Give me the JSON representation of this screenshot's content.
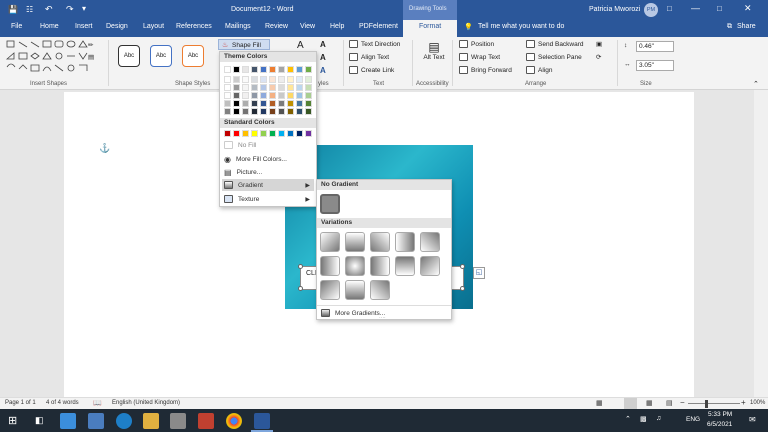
{
  "titlebar": {
    "doc_title": "Document12 - Word",
    "context_tab": "Drawing Tools",
    "search_hint": "Tell me what you want to do",
    "user": "Patricia Mworozi",
    "initials": "PM"
  },
  "tabs": [
    "File",
    "Home",
    "Insert",
    "Design",
    "Layout",
    "References",
    "Mailings",
    "Review",
    "View",
    "Help",
    "PDFelement",
    "Format"
  ],
  "share_label": "Share",
  "ribbon": {
    "groups": {
      "insert_shapes": "Insert Shapes",
      "shape_styles": "Shape Styles",
      "text": "Text",
      "accessibility": "Accessibility",
      "arrange": "Arrange",
      "size": "Size"
    },
    "abc": "Abc",
    "shape_fill": "Shape Fill",
    "text_direction": "Text Direction",
    "align_text": "Align Text",
    "create_link": "Create Link",
    "alt_text": "Alt Text",
    "position": "Position",
    "wrap_text": "Wrap Text",
    "bring_forward": "Bring Forward",
    "send_backward": "Send Backward",
    "selection_pane": "Selection Pane",
    "align": "Align",
    "height": "0.46\"",
    "width": "3.05\"",
    "styles_short": "yles"
  },
  "fill_menu": {
    "theme_colors": "Theme Colors",
    "standard_colors": "Standard Colors",
    "no_fill": "No Fill",
    "more_fill_colors": "More Fill Colors...",
    "picture": "Picture...",
    "gradient": "Gradient",
    "texture": "Texture"
  },
  "gradient_menu": {
    "no_gradient": "No Gradient",
    "variations": "Variations",
    "more_gradients": "More Gradients..."
  },
  "textbox_text": "CLE",
  "status": {
    "page": "Page 1 of 1",
    "words": "4 of 4 words",
    "language": "English (United Kingdom)",
    "zoom": "100%"
  },
  "taskbar": {
    "lang": "ENG",
    "time": "5:33 PM",
    "date": "6/5/2021"
  },
  "colors": {
    "accent": "#2b579a",
    "theme_top": [
      "#ffffff",
      "#000000",
      "#e7e6e6",
      "#44546a",
      "#4472c4",
      "#ed7d31",
      "#a5a5a5",
      "#ffc000",
      "#5b9bd5",
      "#70ad47"
    ],
    "standard": [
      "#c00000",
      "#ff0000",
      "#ffc000",
      "#ffff00",
      "#92d050",
      "#00b050",
      "#00b0f0",
      "#0070c0",
      "#002060",
      "#7030a0"
    ]
  }
}
